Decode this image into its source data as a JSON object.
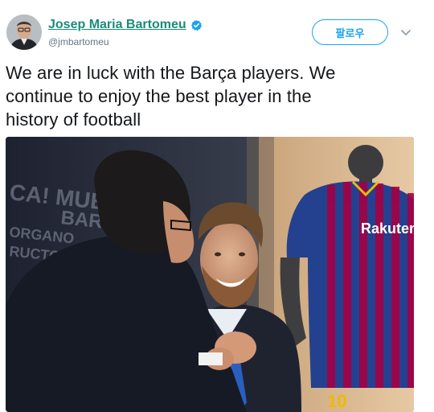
{
  "author": {
    "display_name": "Josep Maria Bartomeu",
    "handle": "@jmbartomeu",
    "verified": true,
    "avatar_icon": "profile-photo"
  },
  "follow_button": {
    "label": "팔로우"
  },
  "menu": {
    "icon": "chevron-down-icon"
  },
  "tweet": {
    "text": "We are in luck with the Barça players. We\ncontinue to enjoy the best player in the\nhistory of football"
  },
  "media": {
    "jersey_sponsor": "Rakuten",
    "backdrop_text": [
      "CA! MUÉ",
      "BAR",
      "ORGANO",
      "RUCTO"
    ],
    "shirt_number": "10"
  },
  "colors": {
    "accent": "#1da1f2",
    "name_link": "#1a8c7a",
    "verified": "#1da1f2"
  }
}
